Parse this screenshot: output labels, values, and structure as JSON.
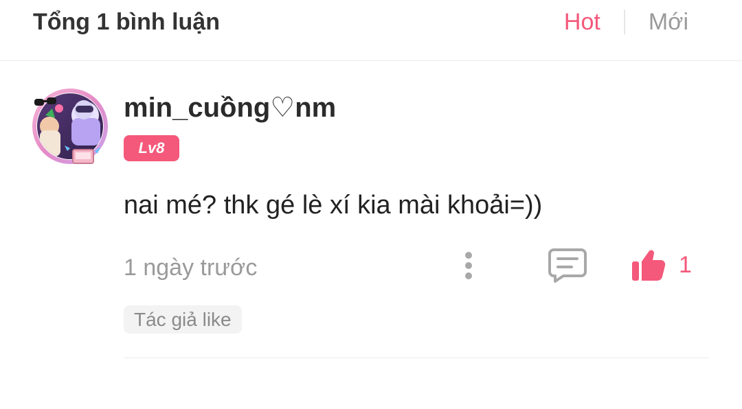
{
  "header": {
    "title": "Tổng 1 bình luận",
    "sort_tabs": [
      {
        "label": "Hot",
        "active": true
      },
      {
        "label": "Mới",
        "active": false
      }
    ],
    "active_color": "#f4587a"
  },
  "comment": {
    "username": "min_cuồng♡nm",
    "level": "Lv8",
    "text": "nai mé? thk gé lè xí kia mài khoải=))",
    "time": "1 ngày trước",
    "like_count": "1",
    "author_tag": "Tác giả like",
    "icons": {
      "more": "more-vertical-icon",
      "reply": "comment-icon",
      "like": "thumbs-up-icon"
    }
  }
}
